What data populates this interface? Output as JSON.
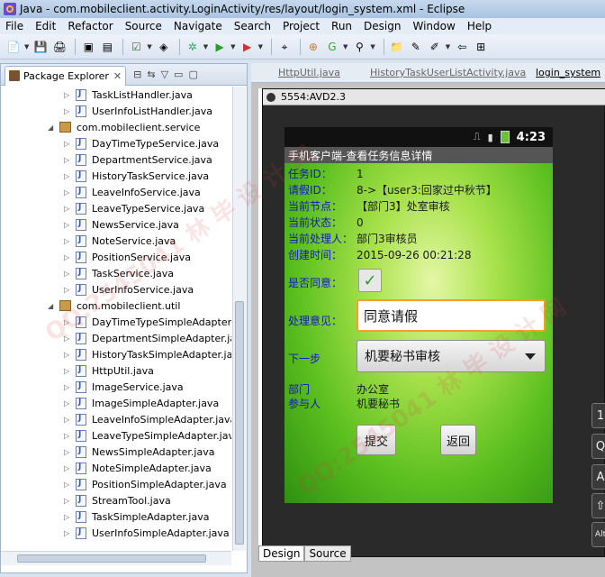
{
  "window": {
    "title": "Java - com.mobileclient.activity.LoginActivity/res/layout/login_system.xml - Eclipse"
  },
  "menu": [
    "File",
    "Edit",
    "Refactor",
    "Source",
    "Navigate",
    "Search",
    "Project",
    "Run",
    "Design",
    "Window",
    "Help"
  ],
  "toolbar_icons": [
    "new-file-icon",
    "save-icon",
    "print-icon",
    "debug-icon",
    "run-icon",
    "external-tools-icon",
    "open-type-icon",
    "search-icon",
    "perspective-icon"
  ],
  "explorer": {
    "tab_label": "Package Explorer",
    "close_glyph": "✕",
    "rows": [
      {
        "kind": "file",
        "label": "TaskListHandler.java"
      },
      {
        "kind": "file",
        "label": "UserInfoListHandler.java"
      },
      {
        "kind": "package",
        "label": "com.mobileclient.service"
      },
      {
        "kind": "file",
        "label": "DayTimeTypeService.java"
      },
      {
        "kind": "file",
        "label": "DepartmentService.java"
      },
      {
        "kind": "file",
        "label": "HistoryTaskService.java"
      },
      {
        "kind": "file",
        "label": "LeaveInfoService.java"
      },
      {
        "kind": "file",
        "label": "LeaveTypeService.java"
      },
      {
        "kind": "file",
        "label": "NewsService.java"
      },
      {
        "kind": "file",
        "label": "NoteService.java"
      },
      {
        "kind": "file",
        "label": "PositionService.java"
      },
      {
        "kind": "file",
        "label": "TaskService.java"
      },
      {
        "kind": "file",
        "label": "UserInfoService.java"
      },
      {
        "kind": "package",
        "label": "com.mobileclient.util"
      },
      {
        "kind": "file",
        "label": "DayTimeTypeSimpleAdapter.j"
      },
      {
        "kind": "file",
        "label": "DepartmentSimpleAdapter.java"
      },
      {
        "kind": "file",
        "label": "HistoryTaskSimpleAdapter.java"
      },
      {
        "kind": "file",
        "label": "HttpUtil.java"
      },
      {
        "kind": "file",
        "label": "ImageService.java"
      },
      {
        "kind": "file",
        "label": "ImageSimpleAdapter.java"
      },
      {
        "kind": "file",
        "label": "LeaveInfoSimpleAdapter.java"
      },
      {
        "kind": "file",
        "label": "LeaveTypeSimpleAdapter.java"
      },
      {
        "kind": "file",
        "label": "NewsSimpleAdapter.java"
      },
      {
        "kind": "file",
        "label": "NoteSimpleAdapter.java"
      },
      {
        "kind": "file",
        "label": "PositionSimpleAdapter.java"
      },
      {
        "kind": "file",
        "label": "StreamTool.java"
      },
      {
        "kind": "file",
        "label": "TaskSimpleAdapter.java"
      },
      {
        "kind": "file",
        "label": "UserInfoSimpleAdapter.java"
      }
    ]
  },
  "editor": {
    "tabs": [
      "HttpUtil.java",
      "HistoryTaskUserListActivity.java",
      "login_system"
    ],
    "bottom_tabs": [
      "Design",
      "Source"
    ]
  },
  "avd": {
    "title": "5554:AVD2.3"
  },
  "phone": {
    "clock": "4:23",
    "app_title": "手机客户端-查看任务信息详情",
    "fields": [
      {
        "label": "任务ID：",
        "value": "1"
      },
      {
        "label": "请假ID：",
        "value": "8->【user3:回家过中秋节】"
      },
      {
        "label": "当前节点：",
        "value": "【部门3】处室审核"
      },
      {
        "label": "当前状态：",
        "value": "0"
      },
      {
        "label": "当前处理人：",
        "value": "部门3审核员"
      },
      {
        "label": "创建时间：",
        "value": "2015-09-26 00:21:28"
      }
    ],
    "agree_label": "是否同意：",
    "agree_checked": true,
    "opinion_label": "处理意见：",
    "opinion_value": "同意请假",
    "next_label": "下一步",
    "next_value": "机要秘书审核",
    "dept_label": "部门",
    "dept_value": "办公室",
    "participant_label": "参与人",
    "participant_value": "机要秘书",
    "submit_label": "提交",
    "back_label": "返回"
  },
  "keyboard_keys": [
    "1",
    "Q",
    "A",
    "⇧",
    "Alt"
  ],
  "watermark_text": "QQ:2545041 林 毕 设 计 网"
}
